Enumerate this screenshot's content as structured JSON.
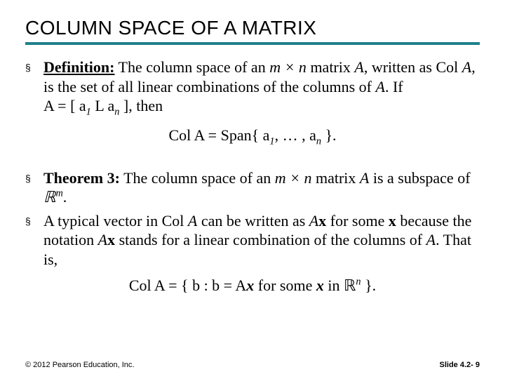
{
  "title": "COLUMN SPACE OF A MATRIX",
  "bullets": {
    "b1": {
      "defLabel": "Definition:",
      "pre": " The column space of an ",
      "mxn": "m × n",
      "post1": " matrix ",
      "A1": "A",
      "post2": ", written as Col ",
      "A2": "A",
      "post3": ", is the set of all linear combinations of the columns of ",
      "A3": "A",
      "post4": ". If ",
      "eqA": "A = [ a",
      "eqA_sub1": "1",
      "eqA_mid": "   L   a",
      "eqA_subn": "n",
      "eqA_close": " ]",
      "post5": ", then"
    },
    "eq1": {
      "lhs": "Col A = Span{ a",
      "s1": "1",
      "mid": ", … , a",
      "sn": "n",
      "rhs": " }."
    },
    "b2": {
      "thmLabel": "Theorem 3:",
      "pre": " The column space of an ",
      "mxn": "m × n",
      "post1": " matrix ",
      "A": "A",
      "post2": " is a subspace of ",
      "Rm": "ℝ",
      "Rm_sup": "m",
      "post3": "."
    },
    "b3": {
      "t1": "A typical vector in Col ",
      "A1": "A",
      "t2": " can be written as ",
      "Ax1": "A",
      "x1": "x",
      "t3": " for some ",
      "x2": "x",
      "t4": " because the notation ",
      "Ax2": "A",
      "x3": "x",
      "t5": " stands for a linear combination of the columns of ",
      "A2": "A",
      "t6": ". That is,"
    },
    "eq2": {
      "lhs": "Col A = { b : b = A",
      "x": "x",
      "mid": " for some ",
      "x2": "x",
      "in": " in ℝ",
      "n": "n",
      "rhs": " }."
    }
  },
  "footer": {
    "left": "© 2012 Pearson Education, Inc.",
    "right": "Slide 4.2- 9"
  }
}
